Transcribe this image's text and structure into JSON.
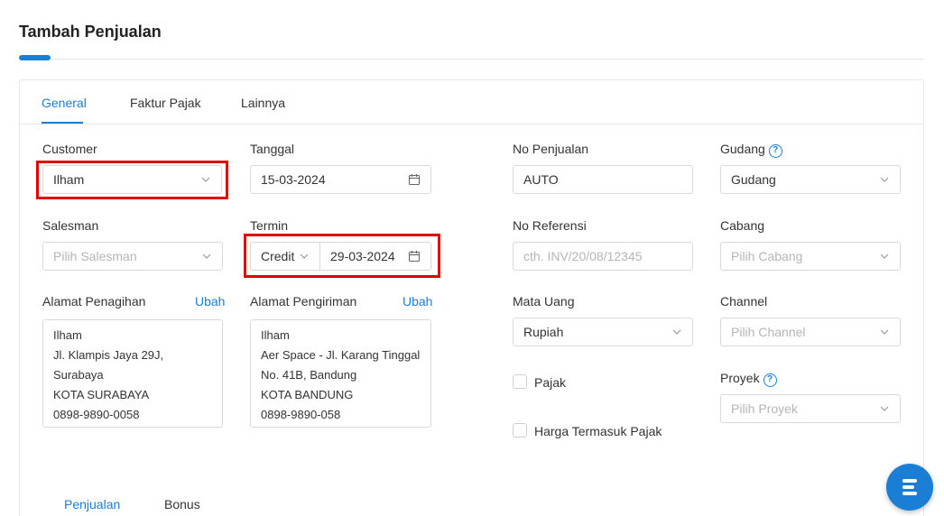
{
  "page": {
    "title": "Tambah Penjualan"
  },
  "tabs": [
    {
      "label": "General",
      "active": true
    },
    {
      "label": "Faktur Pajak",
      "active": false
    },
    {
      "label": "Lainnya",
      "active": false
    }
  ],
  "form": {
    "customer": {
      "label": "Customer",
      "value": "Ilham"
    },
    "tanggal": {
      "label": "Tanggal",
      "value": "15-03-2024"
    },
    "no_penjualan": {
      "label": "No Penjualan",
      "value": "AUTO"
    },
    "gudang": {
      "label": "Gudang",
      "value": "Gudang"
    },
    "salesman": {
      "label": "Salesman",
      "placeholder": "Pilih Salesman"
    },
    "termin": {
      "label": "Termin",
      "type_value": "Credit",
      "date_value": "29-03-2024"
    },
    "no_referensi": {
      "label": "No Referensi",
      "placeholder": "cth. INV/20/08/12345"
    },
    "cabang": {
      "label": "Cabang",
      "placeholder": "Pilih Cabang"
    },
    "alamat_penagihan": {
      "label": "Alamat Penagihan",
      "action": "Ubah",
      "lines": [
        "Ilham",
        "Jl. Klampis Jaya 29J,",
        "Surabaya",
        "KOTA SURABAYA",
        "0898-9890-0058"
      ]
    },
    "alamat_pengiriman": {
      "label": "Alamat Pengiriman",
      "action": "Ubah",
      "lines": [
        "Ilham",
        "Aer Space - Jl. Karang Tinggal",
        "No. 41B, Bandung",
        "KOTA BANDUNG",
        "0898-9890-058"
      ]
    },
    "mata_uang": {
      "label": "Mata Uang",
      "value": "Rupiah"
    },
    "channel": {
      "label": "Channel",
      "placeholder": "Pilih Channel"
    },
    "pajak": {
      "label": "Pajak",
      "checked": false
    },
    "harga_termasuk_pajak": {
      "label": "Harga Termasuk Pajak",
      "checked": false
    },
    "proyek": {
      "label": "Proyek",
      "placeholder": "Pilih Proyek"
    }
  },
  "subtabs": [
    {
      "label": "Penjualan",
      "active": true
    },
    {
      "label": "Bonus",
      "active": false
    }
  ],
  "colors": {
    "accent": "#1a7fd4",
    "highlight": "#e00000"
  },
  "icons": {
    "help": "?"
  }
}
